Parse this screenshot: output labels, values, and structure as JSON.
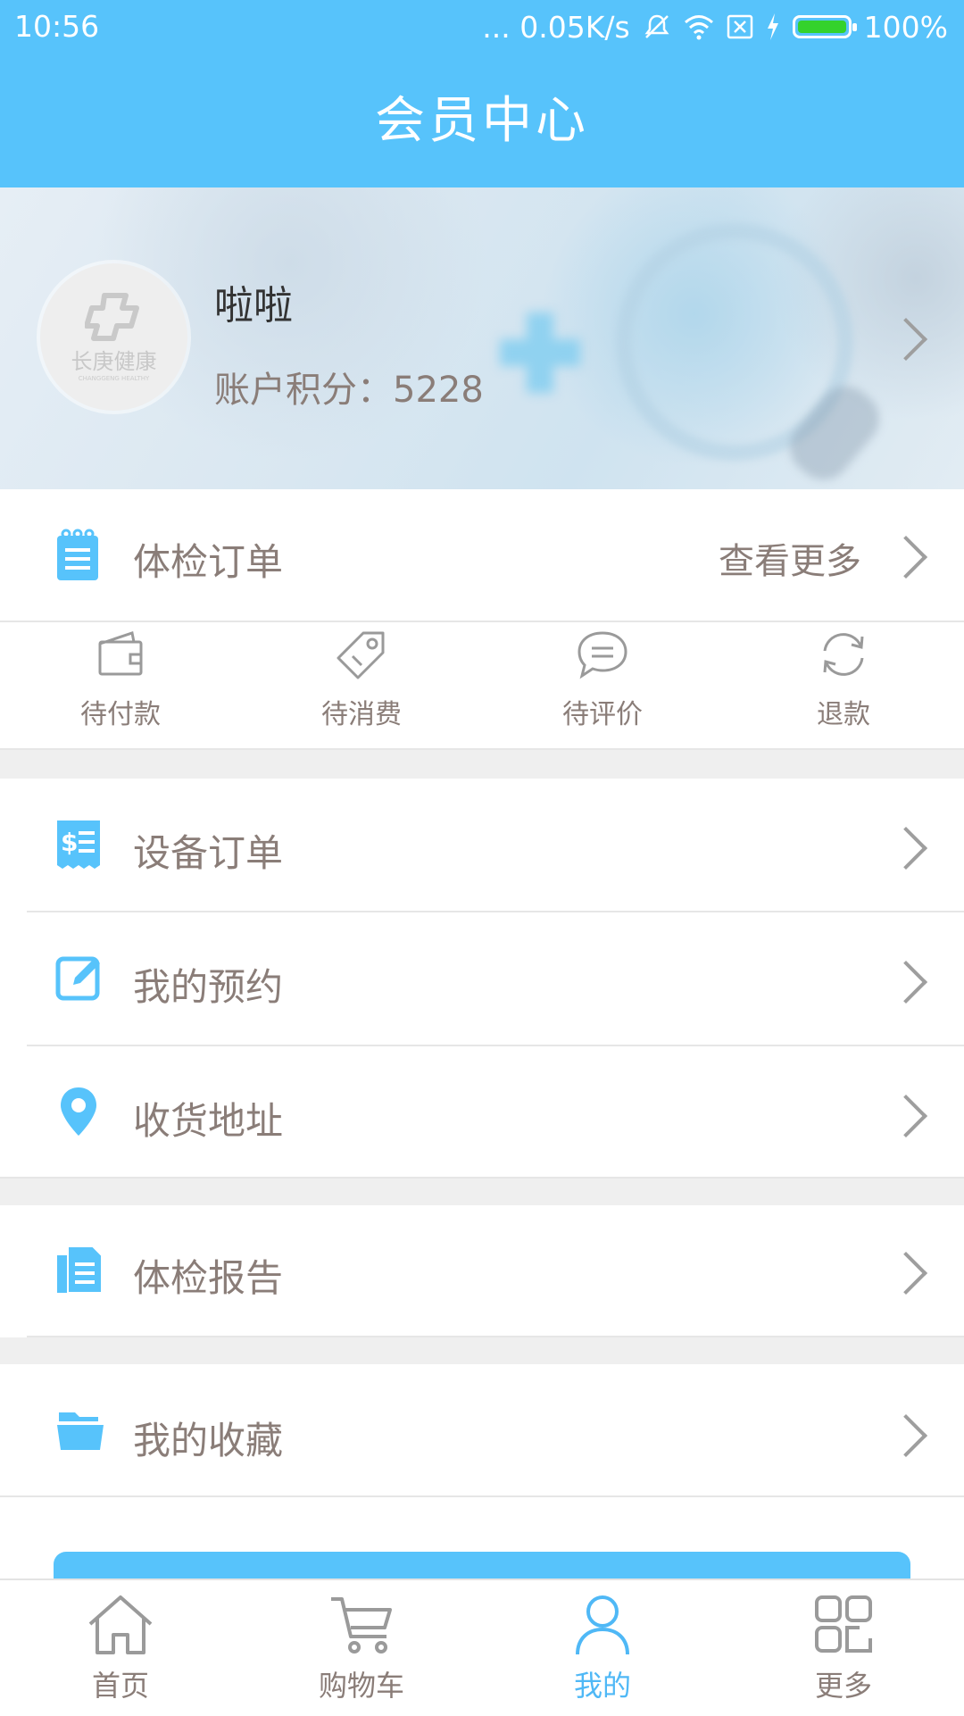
{
  "status_bar": {
    "time": "10:56",
    "network_speed": "... 0.05K/s",
    "battery_percent": "100%",
    "battery_level": 1.0
  },
  "header": {
    "title": "会员中心"
  },
  "profile": {
    "logo_text": "长庚健康",
    "logo_subtext": "CHANGGENG HEALTHY",
    "name": "啦啦",
    "points_label": "账户积分：5228"
  },
  "exam_orders": {
    "label": "体检订单",
    "more_label": "查看更多",
    "sub_items": [
      {
        "label": "待付款",
        "icon": "wallet-icon"
      },
      {
        "label": "待消费",
        "icon": "tag-icon"
      },
      {
        "label": "待评价",
        "icon": "chat-bubble-icon"
      },
      {
        "label": "退款",
        "icon": "refresh-icon"
      }
    ]
  },
  "menu": {
    "device_orders": "设备订单",
    "appointments": "我的预约",
    "addresses": "收货地址",
    "reports": "体检报告",
    "favorites": "我的收藏"
  },
  "tabs": [
    {
      "label": "首页",
      "icon": "home-icon",
      "active": false
    },
    {
      "label": "购物车",
      "icon": "cart-icon",
      "active": false
    },
    {
      "label": "我的",
      "icon": "user-icon",
      "active": true
    },
    {
      "label": "更多",
      "icon": "grid-icon",
      "active": false
    }
  ],
  "colors": {
    "accent": "#57c3fb",
    "tab_active": "#4fb8f6",
    "text": "#8a7d78",
    "battery_fill": "#34d22c"
  }
}
